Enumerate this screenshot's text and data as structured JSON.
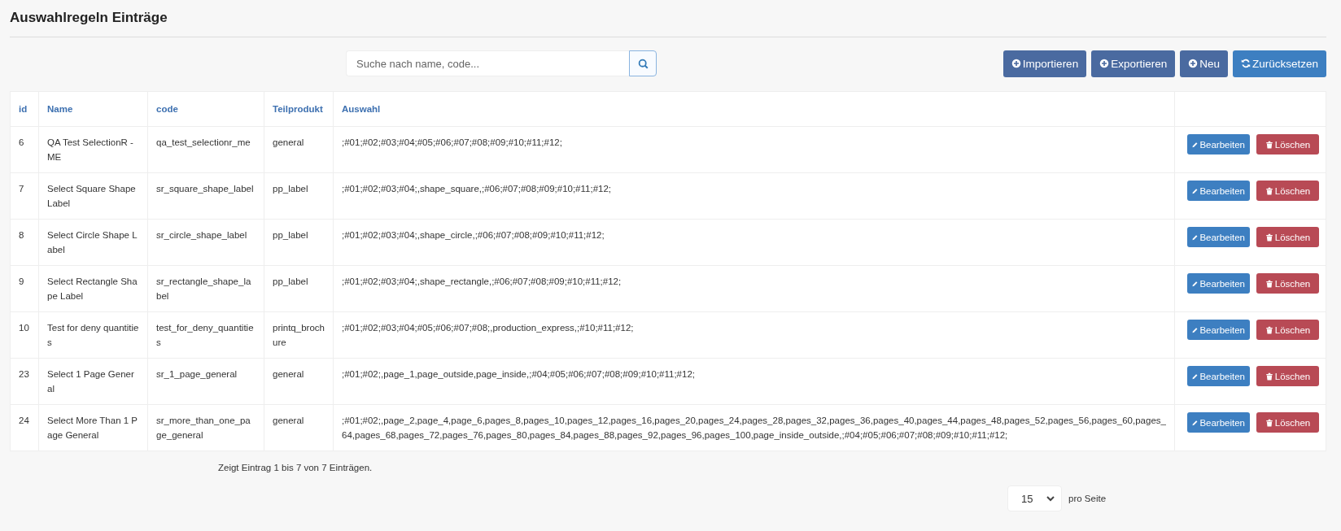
{
  "title": "Auswahlregeln Einträge",
  "search": {
    "placeholder": "Suche nach name, code..."
  },
  "toolbar_buttons": [
    {
      "label": "Importieren",
      "kind": "plus"
    },
    {
      "label": "Exportieren",
      "kind": "plus"
    },
    {
      "label": "Neu",
      "kind": "plus"
    },
    {
      "label": "Zurücksetzen",
      "kind": "reset"
    }
  ],
  "table": {
    "columns": [
      "id",
      "Name",
      "code",
      "Teilprodukt",
      "Auswahl"
    ],
    "rows": [
      {
        "id": "6",
        "name": "QA Test SelectionR - ME",
        "code": "qa_test_selectionr_me",
        "teilprodukt": "general",
        "auswahl": ";#01;#02;#03;#04;#05;#06;#07;#08;#09;#10;#11;#12;",
        "actions": [
          "Bearbeiten",
          "Löschen"
        ]
      },
      {
        "id": "7",
        "name": "Select Square Shape Label",
        "code": "sr_square_shape_label",
        "teilprodukt": "pp_label",
        "auswahl": ";#01;#02;#03;#04;,shape_square,;#06;#07;#08;#09;#10;#11;#12;",
        "actions": [
          "Bearbeiten",
          "Löschen"
        ]
      },
      {
        "id": "8",
        "name": "Select Circle Shape Label",
        "code": "sr_circle_shape_label",
        "teilprodukt": "pp_label",
        "auswahl": ";#01;#02;#03;#04;,shape_circle,;#06;#07;#08;#09;#10;#11;#12;",
        "actions": [
          "Bearbeiten",
          "Löschen"
        ]
      },
      {
        "id": "9",
        "name": "Select Rectangle Shape Label",
        "code": "sr_rectangle_shape_label",
        "teilprodukt": "pp_label",
        "auswahl": ";#01;#02;#03;#04;,shape_rectangle,;#06;#07;#08;#09;#10;#11;#12;",
        "actions": [
          "Bearbeiten",
          "Löschen"
        ]
      },
      {
        "id": "10",
        "name": "Test for deny quantities",
        "code": "test_for_deny_quantities",
        "teilprodukt": "printq_brochure",
        "auswahl": ";#01;#02;#03;#04;#05;#06;#07;#08;,production_express,;#10;#11;#12;",
        "actions": [
          "Bearbeiten",
          "Löschen"
        ]
      },
      {
        "id": "23",
        "name": "Select 1 Page General",
        "code": "sr_1_page_general",
        "teilprodukt": "general",
        "auswahl": ";#01;#02;,page_1,page_outside,page_inside,;#04;#05;#06;#07;#08;#09;#10;#11;#12;",
        "actions": [
          "Bearbeiten",
          "Löschen"
        ]
      },
      {
        "id": "24",
        "name": "Select More Than 1 Page General",
        "code": "sr_more_than_one_page_general",
        "teilprodukt": "general",
        "auswahl": ";#01;#02;,page_2,page_4,page_6,pages_8,pages_10,pages_12,pages_16,pages_20,pages_24,pages_28,pages_32,pages_36,pages_40,pages_44,pages_48,pages_52,pages_56,pages_60,pages_64,pages_68,pages_72,pages_76,pages_80,pages_84,pages_88,pages_92,pages_96,pages_100,page_inside_outside,;#04;#05;#06;#07;#08;#09;#10;#11;#12;",
        "actions": [
          "Bearbeiten",
          "Löschen"
        ]
      }
    ]
  },
  "summary": "Zeigt Eintrag 1 bis 7 von 7 Einträgen.",
  "page_size": {
    "value": "15",
    "label": "pro Seite"
  }
}
